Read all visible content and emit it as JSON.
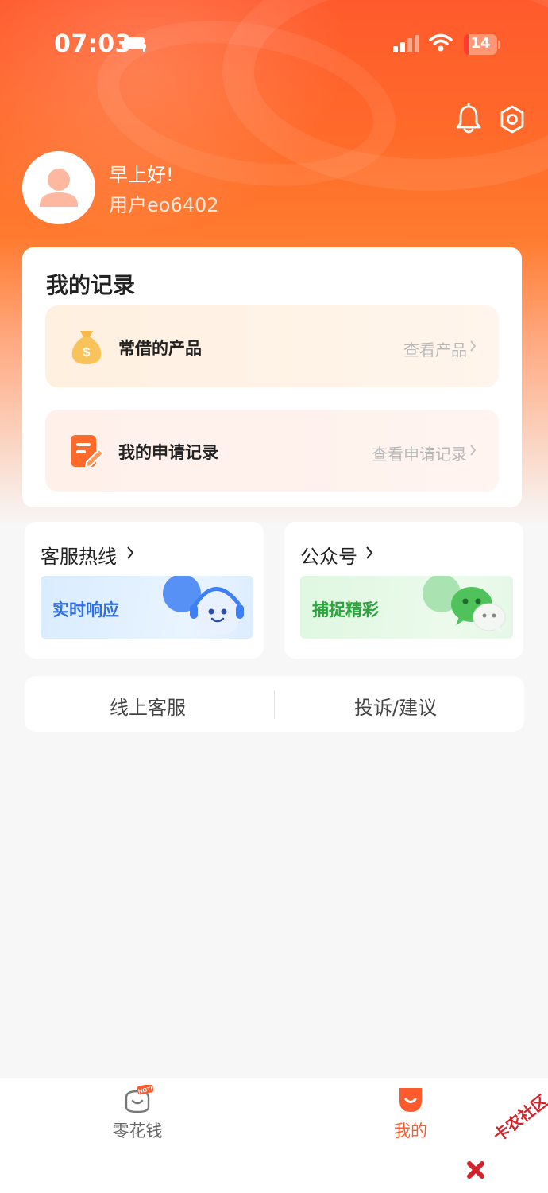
{
  "status_bar": {
    "time": "07:03",
    "battery": "14",
    "battery_percent": 14
  },
  "profile": {
    "greeting": "早上好!",
    "username": "用户eo6402"
  },
  "records": {
    "title": "我的记录",
    "items": [
      {
        "label": "常借的产品",
        "link": "查看产品",
        "icon": "money-bag-icon"
      },
      {
        "label": "我的申请记录",
        "link": "查看申请记录",
        "icon": "application-edit-icon"
      }
    ]
  },
  "services": [
    {
      "title": "客服热线",
      "banner": "实时响应",
      "icon": "headset-robot-icon"
    },
    {
      "title": "公众号",
      "banner": "捕捉精彩",
      "icon": "wechat-icon"
    }
  ],
  "actions": [
    "线上客服",
    "投诉/建议"
  ],
  "tabs": [
    {
      "label": "零花钱",
      "badge": "HOT!",
      "active": false
    },
    {
      "label": "我的",
      "active": true
    }
  ],
  "watermark": "卡农社区",
  "colors": {
    "brand": "#ff5a2c",
    "service_blue": "#2f6fe0",
    "service_green": "#2aa53c"
  }
}
